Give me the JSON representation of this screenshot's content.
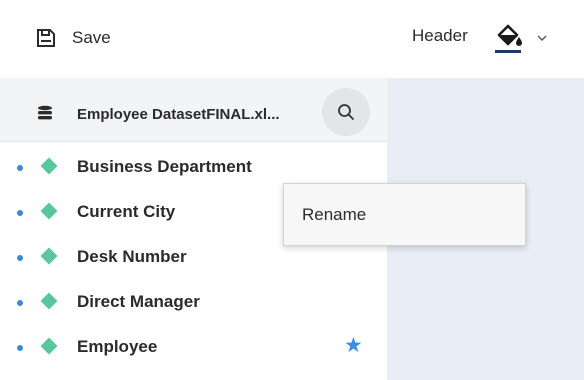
{
  "toolbar": {
    "save_label": "Save",
    "save_icon": "save-icon",
    "header_label": "Header",
    "fill_icon": "paint-bucket-icon",
    "fill_color": "#1f3a67",
    "dropdown_icon": "chevron-down-icon"
  },
  "sidebar": {
    "dataset_name": "Employee DatasetFINAL.xl...",
    "dataset_icon": "database-icon",
    "search_icon": "search-icon",
    "fields": [
      {
        "label": "Business Department",
        "starred": false
      },
      {
        "label": "Current City",
        "starred": false
      },
      {
        "label": "Desk Number",
        "starred": false
      },
      {
        "label": "Direct Manager",
        "starred": false
      },
      {
        "label": "Employee",
        "starred": true
      }
    ]
  },
  "context_menu": {
    "items": [
      {
        "label": "Rename"
      }
    ]
  },
  "colors": {
    "accent_blue": "#3a8ee6",
    "field_green": "#59c79b",
    "canvas_bg": "#e8edf6"
  }
}
